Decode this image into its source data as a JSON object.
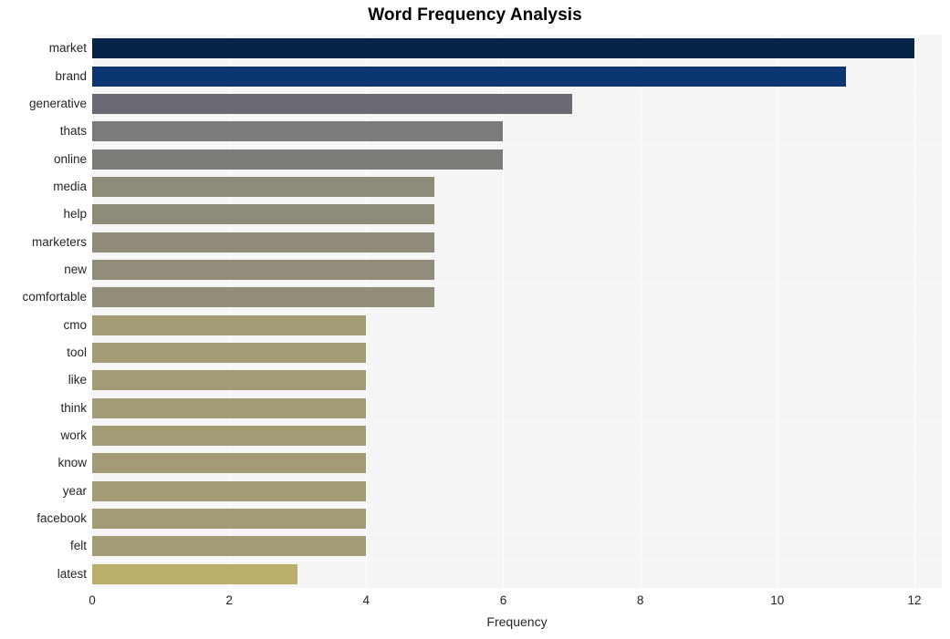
{
  "chart_data": {
    "type": "bar",
    "orientation": "horizontal",
    "title": "Word Frequency Analysis",
    "xlabel": "Frequency",
    "ylabel": "",
    "xlim": [
      0,
      12.4
    ],
    "xticks": [
      0,
      2,
      4,
      6,
      8,
      10,
      12
    ],
    "xtick_labels": [
      "0",
      "2",
      "4",
      "6",
      "8",
      "10",
      "12"
    ],
    "grid": true,
    "legend": false,
    "categories": [
      "market",
      "brand",
      "generative",
      "thats",
      "online",
      "media",
      "help",
      "marketers",
      "new",
      "comfortable",
      "cmo",
      "tool",
      "like",
      "think",
      "work",
      "know",
      "year",
      "facebook",
      "felt",
      "latest"
    ],
    "values": [
      12,
      11,
      7,
      6,
      6,
      5,
      5,
      5,
      5,
      5,
      4,
      4,
      4,
      4,
      4,
      4,
      4,
      4,
      4,
      3
    ],
    "bar_colors": [
      "#082348",
      "#0a3571",
      "#696a73",
      "#7b7b7a",
      "#7d7c78",
      "#8f8b79",
      "#8f8b79",
      "#918c79",
      "#928d7a",
      "#938e7a",
      "#a39a76",
      "#a39a76",
      "#a39a76",
      "#a39a76",
      "#a39a76",
      "#a39a76",
      "#a39a76",
      "#a39a76",
      "#a39a76",
      "#bbae6b"
    ],
    "plot_background": "#f5f5f5",
    "figure_background": "#ffffff",
    "gridline_color": "#ffffff",
    "text_color": "#262626"
  }
}
